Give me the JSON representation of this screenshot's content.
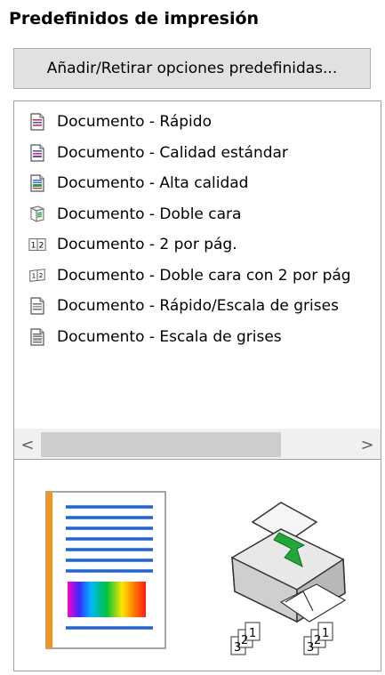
{
  "panel": {
    "title": "Predefinidos de impresión",
    "add_remove_label": "Añadir/Retirar opciones predefinidas..."
  },
  "presets": [
    {
      "label": "Documento - Rápido",
      "icon": "fast-document-icon"
    },
    {
      "label": "Documento - Calidad estándar",
      "icon": "standard-quality-document-icon"
    },
    {
      "label": "Documento - Alta calidad",
      "icon": "high-quality-document-icon"
    },
    {
      "label": "Documento - Doble cara",
      "icon": "two-sided-document-icon"
    },
    {
      "label": "Documento - 2 por pág.",
      "icon": "two-per-page-icon"
    },
    {
      "label": "Documento - Doble cara con 2 por pág",
      "icon": "two-sided-two-per-page-icon"
    },
    {
      "label": "Documento - Rápido/Escala de grises",
      "icon": "fast-grayscale-document-icon"
    },
    {
      "label": "Documento - Escala de grises",
      "icon": "grayscale-document-icon"
    }
  ],
  "scrollbar": {
    "left_arrow": "<",
    "right_arrow": ">",
    "position": 0.0
  },
  "preview": {
    "collate_label_1": "1",
    "collate_label_2": "2",
    "collate_label_3": "3"
  },
  "colors": {
    "accent_orange": "#f7941d",
    "line_blue": "#1e63d9",
    "arrow_green": "#22a83a",
    "button_bg": "#e1e1e1",
    "scrollbar_thumb": "#cdcdcd"
  }
}
